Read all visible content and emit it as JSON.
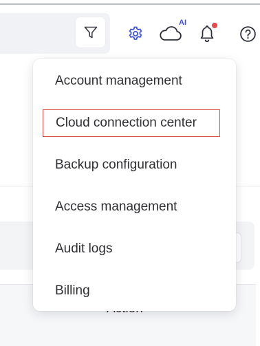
{
  "topbar": {
    "cloud_badge": "AI",
    "icons": [
      "filter-icon",
      "gear-icon",
      "cloud-icon",
      "bell-icon",
      "help-icon"
    ],
    "notification_dot_color": "#e5484d",
    "accent_color": "#3b4fe0"
  },
  "background": {
    "table_action_header": "Action"
  },
  "menu": {
    "items": [
      {
        "label": "Account management"
      },
      {
        "label": "Cloud connection center"
      },
      {
        "label": "Backup configuration"
      },
      {
        "label": "Access management"
      },
      {
        "label": "Audit logs"
      },
      {
        "label": "Billing"
      }
    ],
    "highlighted_index": 1,
    "highlight_color": "#d9534f"
  }
}
